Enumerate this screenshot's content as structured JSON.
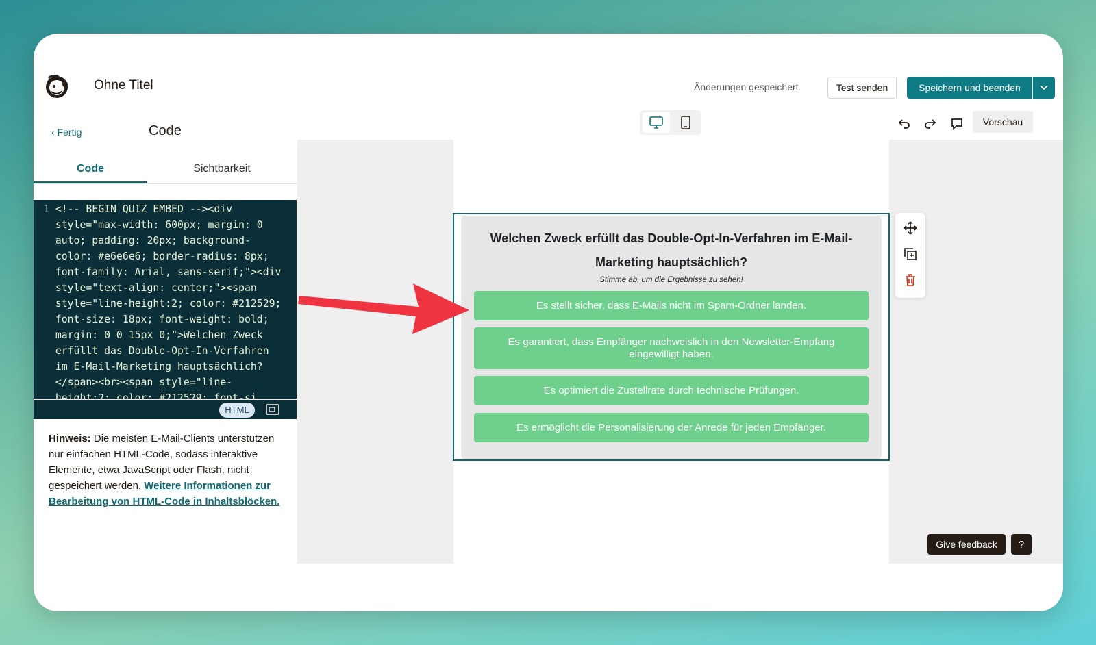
{
  "app": {
    "title": "Ohne Titel",
    "status": "Änderungen gespeichert",
    "test_button": "Test senden",
    "save_button": "Speichern und beenden",
    "preview_button": "Vorschau",
    "brand_color": "#0f7b84"
  },
  "panel": {
    "back_label": "Fertig",
    "title": "Code",
    "tabs": [
      {
        "label": "Code",
        "active": true
      },
      {
        "label": "Sichtbarkeit",
        "active": false
      }
    ],
    "editor": {
      "line_number": "1",
      "lines": [
        "<!-- BEGIN QUIZ EMBED --><div",
        "style=\"max-width: 600px; margin: 0",
        "auto; padding: 20px; background-",
        "color: #e6e6e6; border-radius: 8px;",
        "font-family: Arial, sans-serif;\"><div",
        "style=\"text-align: center;\"><span",
        "style=\"line-height:2; color: #212529;",
        "font-size: 18px; font-weight: bold;",
        "margin: 0 0 15px 0;\">Welchen Zweck",
        "erfüllt das Double-Opt-In-Verfahren",
        "im E-Mail-Marketing hauptsächlich?",
        "</span><br><span style=\"line-",
        "height:2; color: #212529; font-si"
      ],
      "mode_badge": "HTML"
    },
    "hint": {
      "label": "Hinweis:",
      "text": "Die meisten E-Mail-Clients unterstützen nur einfachen HTML-Code, sodass interaktive Elemente, etwa JavaScript oder Flash, nicht gespeichert werden.",
      "link": "Weitere Informationen zur Bearbeitung von HTML-Code in Inhaltsblöcken."
    }
  },
  "quiz": {
    "question": "Welchen Zweck erfüllt das Double-Opt-In-Verfahren im E-Mail-Marketing hauptsächlich?",
    "subtitle": "Stimme ab, um die Ergebnisse zu sehen!",
    "options": [
      "Es stellt sicher, dass E-Mails nicht im Spam-Ordner landen.",
      "Es garantiert, dass Empfänger nachweislich in den Newsletter-Empfang eingewilligt haben.",
      "Es optimiert die Zustellrate durch technische Prüfungen.",
      "Es ermöglicht die Personalisierung der Anrede für jeden Empfänger."
    ],
    "option_color": "#6fcf8c",
    "background": "#e6e6e6"
  },
  "footer": {
    "feedback_button": "Give feedback",
    "help_button": "?"
  }
}
